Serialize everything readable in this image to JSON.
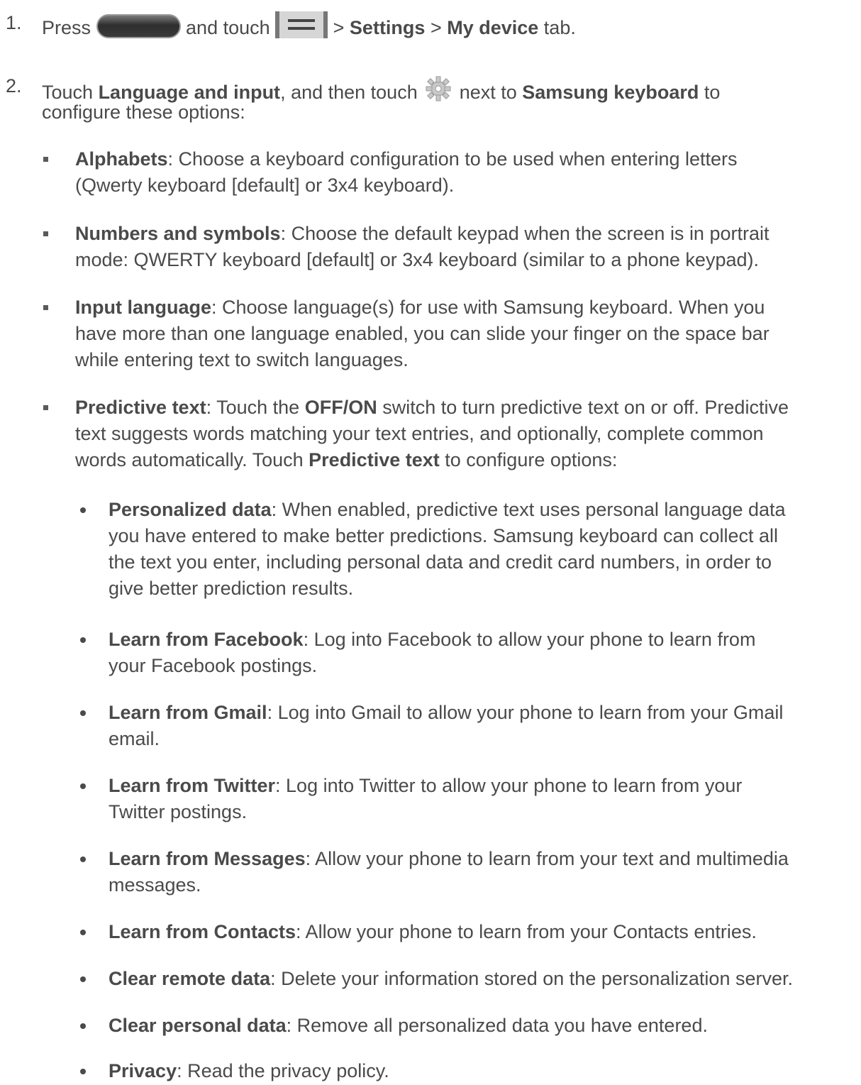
{
  "steps": [
    {
      "num": "1.",
      "parts": [
        "Press ",
        " and touch ",
        " > ",
        "Settings",
        " > ",
        "My device",
        " tab."
      ]
    },
    {
      "num": "2.",
      "parts": [
        "Touch ",
        "Language and input",
        ", and then touch ",
        " next to ",
        "Samsung keyboard",
        " to",
        "configure these options:"
      ]
    }
  ],
  "options": [
    {
      "term": "Alphabets",
      "lines": [
        ": Choose a keyboard configuration to be used when entering letters",
        "(Qwerty keyboard [default] or 3x4 keyboard)."
      ]
    },
    {
      "term": "Numbers and symbols",
      "lines": [
        ": Choose the default keypad when the screen is in portrait",
        "mode: QWERTY keyboard [default] or 3x4 keyboard (similar to a phone keypad)."
      ]
    },
    {
      "term": "Input language",
      "lines": [
        ": Choose language(s) for use with Samsung keyboard. When you",
        "have more than one language enabled, you can slide your finger on the space bar",
        "while entering text to switch languages."
      ]
    },
    {
      "term": "Predictive text",
      "line1a": ": Touch the ",
      "line1b": "OFF/ON",
      "line1c": " switch to turn predictive text on or off. Predictive",
      "line2": "text suggests words matching your text entries, and optionally, complete common",
      "line3a": "words automatically. Touch ",
      "line3b": "Predictive text",
      "line3c": " to configure options:"
    }
  ],
  "sub_options": [
    {
      "term": "Personalized data",
      "lines": [
        ": When enabled, predictive text uses personal language data",
        "you have entered to make better predictions. Samsung keyboard can collect all",
        "the text you enter, including personal data and credit card numbers, in order to",
        "give better prediction results."
      ]
    },
    {
      "term": "Learn from Facebook",
      "lines": [
        ": Log into Facebook to allow your phone to learn from",
        "your Facebook postings."
      ]
    },
    {
      "term": "Learn from Gmail",
      "lines": [
        ": Log into Gmail to allow your phone to learn from your Gmail",
        "email."
      ]
    },
    {
      "term": "Learn from Twitter",
      "lines": [
        ": Log into Twitter to allow your phone to learn from your",
        "Twitter postings."
      ]
    },
    {
      "term": "Learn from Messages",
      "lines": [
        ": Allow your phone to learn from your text and multimedia",
        "messages."
      ]
    },
    {
      "term": "Learn from Contacts",
      "lines": [
        ": Allow your phone to learn from your Contacts entries."
      ]
    },
    {
      "term": "Clear remote data",
      "lines": [
        ": Delete your information stored on the personalization server."
      ]
    },
    {
      "term": "Clear personal data",
      "lines": [
        ": Remove all personalized data you have entered."
      ]
    },
    {
      "term": "Privacy",
      "lines": [
        ": Read the privacy policy."
      ]
    }
  ],
  "icons": {
    "home": "home-key-icon",
    "menu": "menu-key-icon",
    "gear": "settings-gear-icon"
  }
}
